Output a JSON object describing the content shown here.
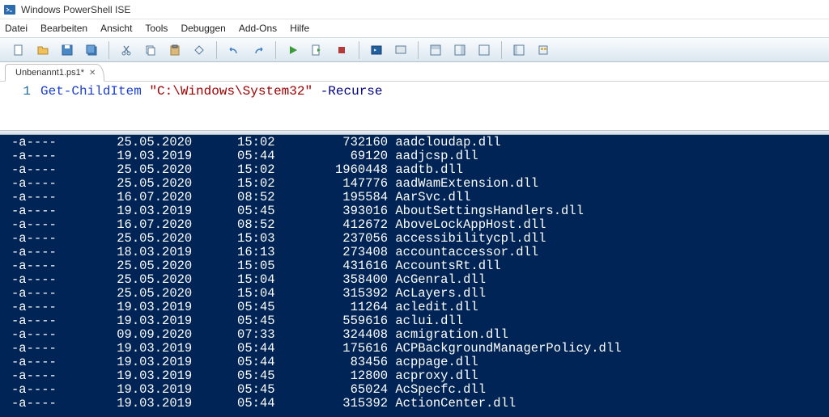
{
  "window": {
    "title": "Windows PowerShell ISE"
  },
  "menu": [
    "Datei",
    "Bearbeiten",
    "Ansicht",
    "Tools",
    "Debuggen",
    "Add-Ons",
    "Hilfe"
  ],
  "tab": {
    "label": "Unbenannt1.ps1*",
    "close": "✕"
  },
  "editor": {
    "line_number": "1",
    "cmdlet": "Get-ChildItem",
    "string": "\"C:\\Windows\\System32\"",
    "param": "-Recurse"
  },
  "console_rows": [
    {
      "mode": "-a----",
      "date": "25.05.2020",
      "time": "15:02",
      "size": "732160",
      "name": "aadcloudap.dll"
    },
    {
      "mode": "-a----",
      "date": "19.03.2019",
      "time": "05:44",
      "size": "69120",
      "name": "aadjcsp.dll"
    },
    {
      "mode": "-a----",
      "date": "25.05.2020",
      "time": "15:02",
      "size": "1960448",
      "name": "aadtb.dll"
    },
    {
      "mode": "-a----",
      "date": "25.05.2020",
      "time": "15:02",
      "size": "147776",
      "name": "aadWamExtension.dll"
    },
    {
      "mode": "-a----",
      "date": "16.07.2020",
      "time": "08:52",
      "size": "195584",
      "name": "AarSvc.dll"
    },
    {
      "mode": "-a----",
      "date": "19.03.2019",
      "time": "05:45",
      "size": "393016",
      "name": "AboutSettingsHandlers.dll"
    },
    {
      "mode": "-a----",
      "date": "16.07.2020",
      "time": "08:52",
      "size": "412672",
      "name": "AboveLockAppHost.dll"
    },
    {
      "mode": "-a----",
      "date": "25.05.2020",
      "time": "15:03",
      "size": "237056",
      "name": "accessibilitycpl.dll"
    },
    {
      "mode": "-a----",
      "date": "18.03.2019",
      "time": "16:13",
      "size": "273408",
      "name": "accountaccessor.dll"
    },
    {
      "mode": "-a----",
      "date": "25.05.2020",
      "time": "15:05",
      "size": "431616",
      "name": "AccountsRt.dll"
    },
    {
      "mode": "-a----",
      "date": "25.05.2020",
      "time": "15:04",
      "size": "358400",
      "name": "AcGenral.dll"
    },
    {
      "mode": "-a----",
      "date": "25.05.2020",
      "time": "15:04",
      "size": "315392",
      "name": "AcLayers.dll"
    },
    {
      "mode": "-a----",
      "date": "19.03.2019",
      "time": "05:45",
      "size": "11264",
      "name": "acledit.dll"
    },
    {
      "mode": "-a----",
      "date": "19.03.2019",
      "time": "05:45",
      "size": "559616",
      "name": "aclui.dll"
    },
    {
      "mode": "-a----",
      "date": "09.09.2020",
      "time": "07:33",
      "size": "324408",
      "name": "acmigration.dll"
    },
    {
      "mode": "-a----",
      "date": "19.03.2019",
      "time": "05:44",
      "size": "175616",
      "name": "ACPBackgroundManagerPolicy.dll"
    },
    {
      "mode": "-a----",
      "date": "19.03.2019",
      "time": "05:44",
      "size": "83456",
      "name": "acppage.dll"
    },
    {
      "mode": "-a----",
      "date": "19.03.2019",
      "time": "05:45",
      "size": "12800",
      "name": "acproxy.dll"
    },
    {
      "mode": "-a----",
      "date": "19.03.2019",
      "time": "05:45",
      "size": "65024",
      "name": "AcSpecfc.dll"
    },
    {
      "mode": "-a----",
      "date": "19.03.2019",
      "time": "05:44",
      "size": "315392",
      "name": "ActionCenter.dll"
    }
  ]
}
